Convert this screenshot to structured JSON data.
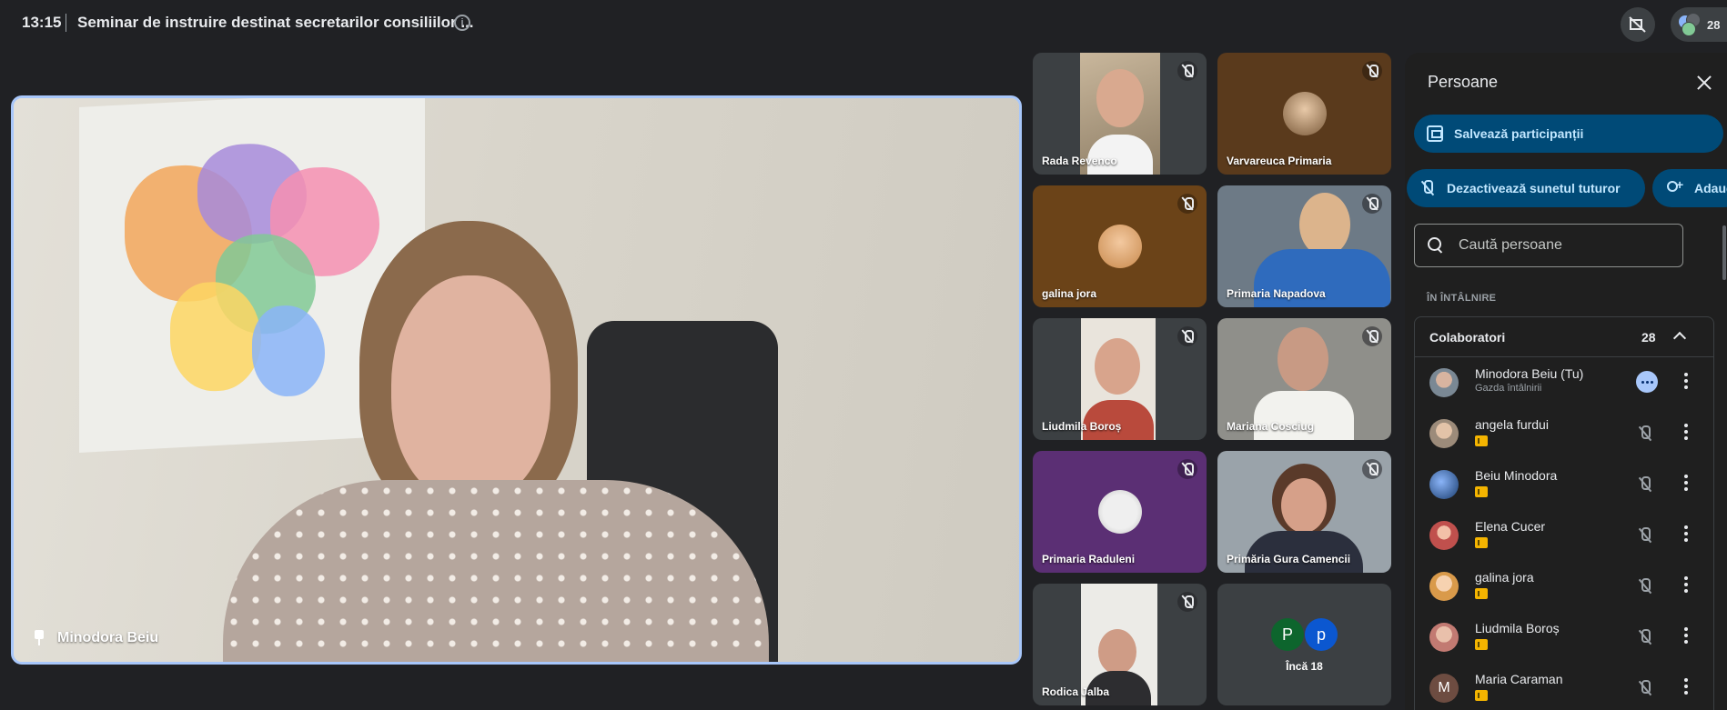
{
  "topbar": {
    "time": "13:15",
    "title": "Seminar de instruire destinat secretarilor consiliilor ...",
    "participant_count": "28"
  },
  "main_speaker": {
    "name": "Minodora Beiu"
  },
  "tiles": [
    {
      "name": "Rada Revenco"
    },
    {
      "name": "Varvareuca Primaria"
    },
    {
      "name": "galina jora"
    },
    {
      "name": "Primaria Napadova"
    },
    {
      "name": "Liudmila Boroș"
    },
    {
      "name": "Mariana Cosciug"
    },
    {
      "name": "Primaria Raduleni"
    },
    {
      "name": "Primăria Gura Camencii"
    },
    {
      "name": "Rodica Jalba"
    },
    {
      "name": "Încă 18",
      "avatars": [
        "P",
        "p"
      ]
    }
  ],
  "panel": {
    "title": "Persoane",
    "save_label": "Salvează participanții",
    "mute_all_label": "Dezactivează sunetul tuturor",
    "add_label": "Adaug",
    "search_placeholder": "Caută persoane",
    "section_label": "ÎN ÎNTÂLNIRE",
    "group_title": "Colaboratori",
    "group_count": "28",
    "people": [
      {
        "name": "Minodora Beiu (Tu)",
        "sub": "Gazda întâlnirii"
      },
      {
        "name": "angela furdui"
      },
      {
        "name": "Beiu Minodora"
      },
      {
        "name": "Elena Cucer"
      },
      {
        "name": "galina jora"
      },
      {
        "name": "Liudmila Boroș"
      },
      {
        "name": "Maria Caraman",
        "initial": "M"
      }
    ]
  },
  "colors": {
    "background": "#202124",
    "accent_border": "#a8c7fa",
    "pill_bg": "#004a77",
    "pill_text": "#c2e7ff"
  }
}
